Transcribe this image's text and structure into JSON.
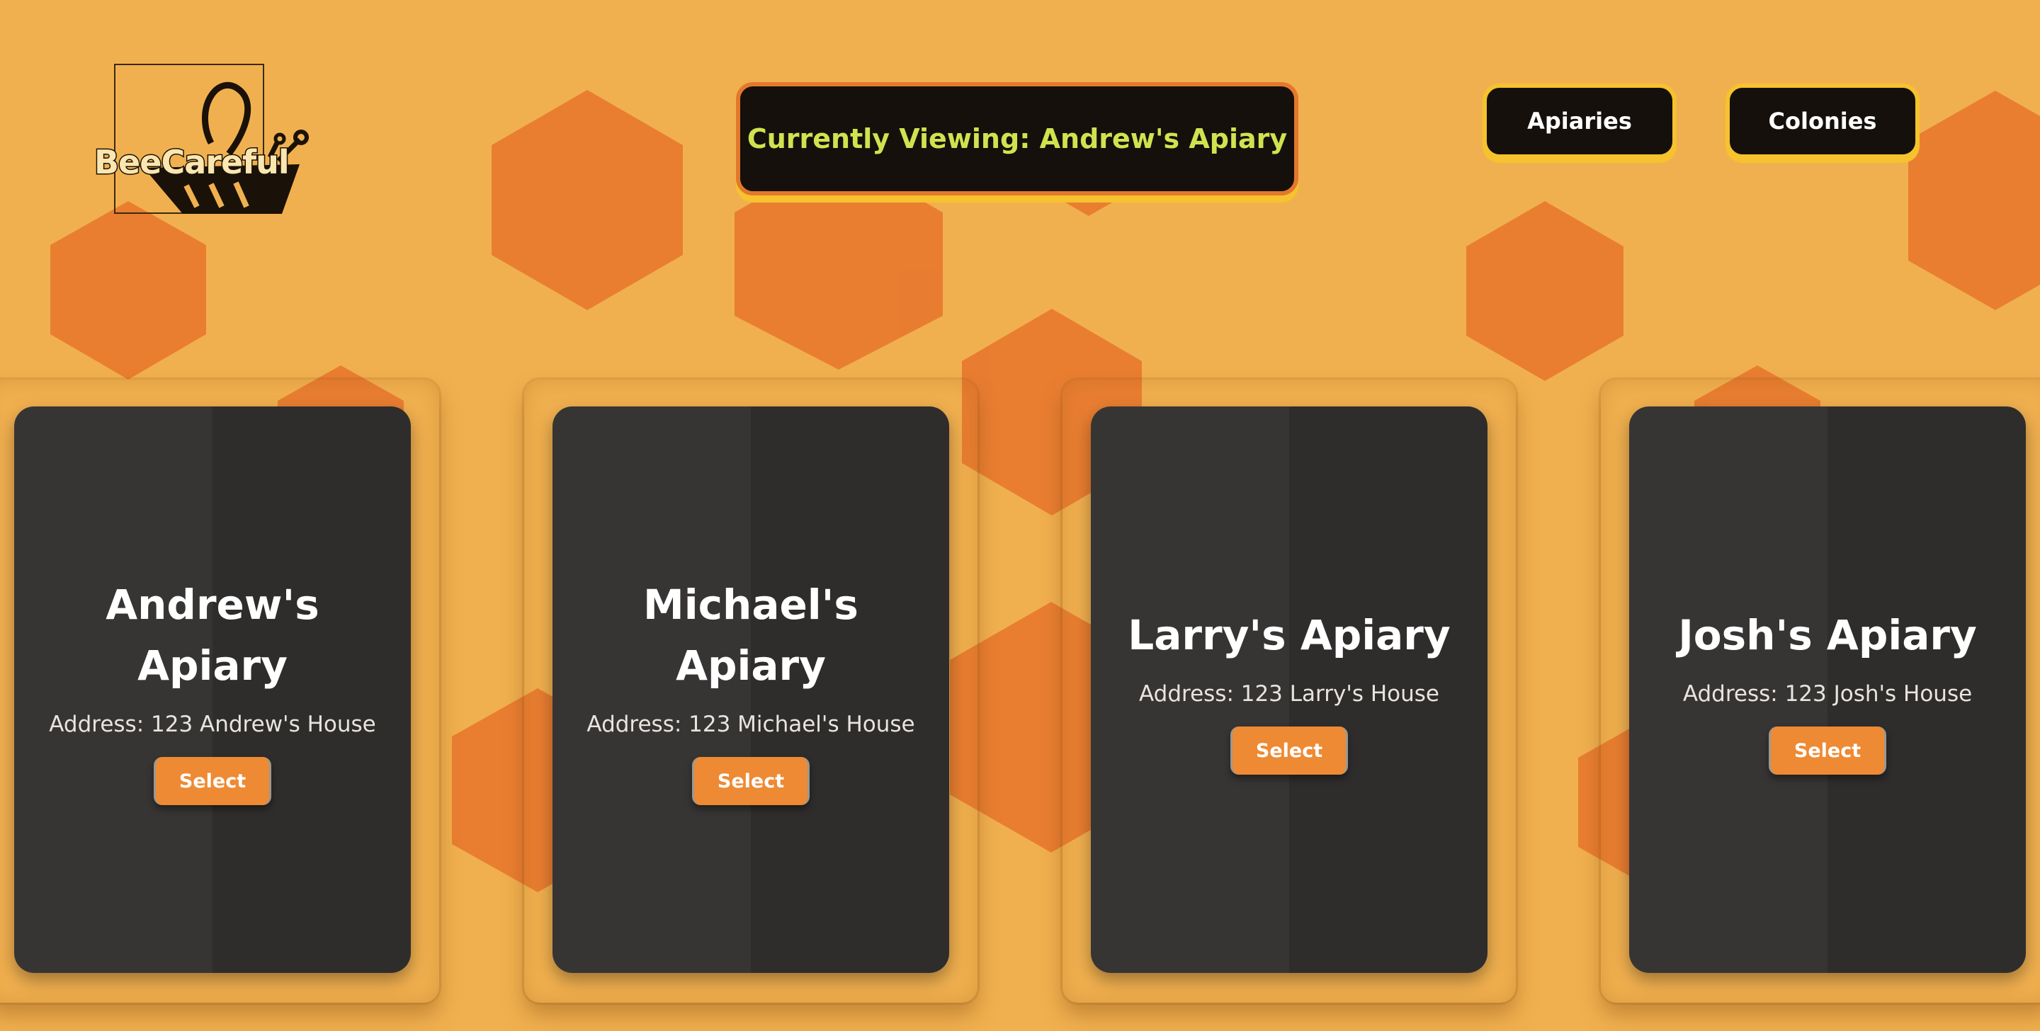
{
  "brand": {
    "logo_text": "BeeCareful"
  },
  "banner": {
    "viewing_label": "Currently Viewing: Andrew's Apiary"
  },
  "nav": {
    "apiaries_label": "Apiaries",
    "colonies_label": "Colonies"
  },
  "apiaries": [
    {
      "title": "Andrew's Apiary",
      "address": "Address: 123 Andrew's House",
      "button": "Select"
    },
    {
      "title": "Michael's Apiary",
      "address": "Address: 123 Michael's House",
      "button": "Select"
    },
    {
      "title": "Larry's Apiary",
      "address": "Address: 123 Larry's House",
      "button": "Select"
    },
    {
      "title": "Josh's Apiary",
      "address": "Address: 123 Josh's House",
      "button": "Select"
    }
  ],
  "colors": {
    "background": "#f1b04f",
    "hexagon": "#e8792f",
    "accent_yellow": "#f6c22e",
    "banner_text": "#d0e34f",
    "card_dark": "#373534",
    "button_orange": "#ee8a33"
  }
}
